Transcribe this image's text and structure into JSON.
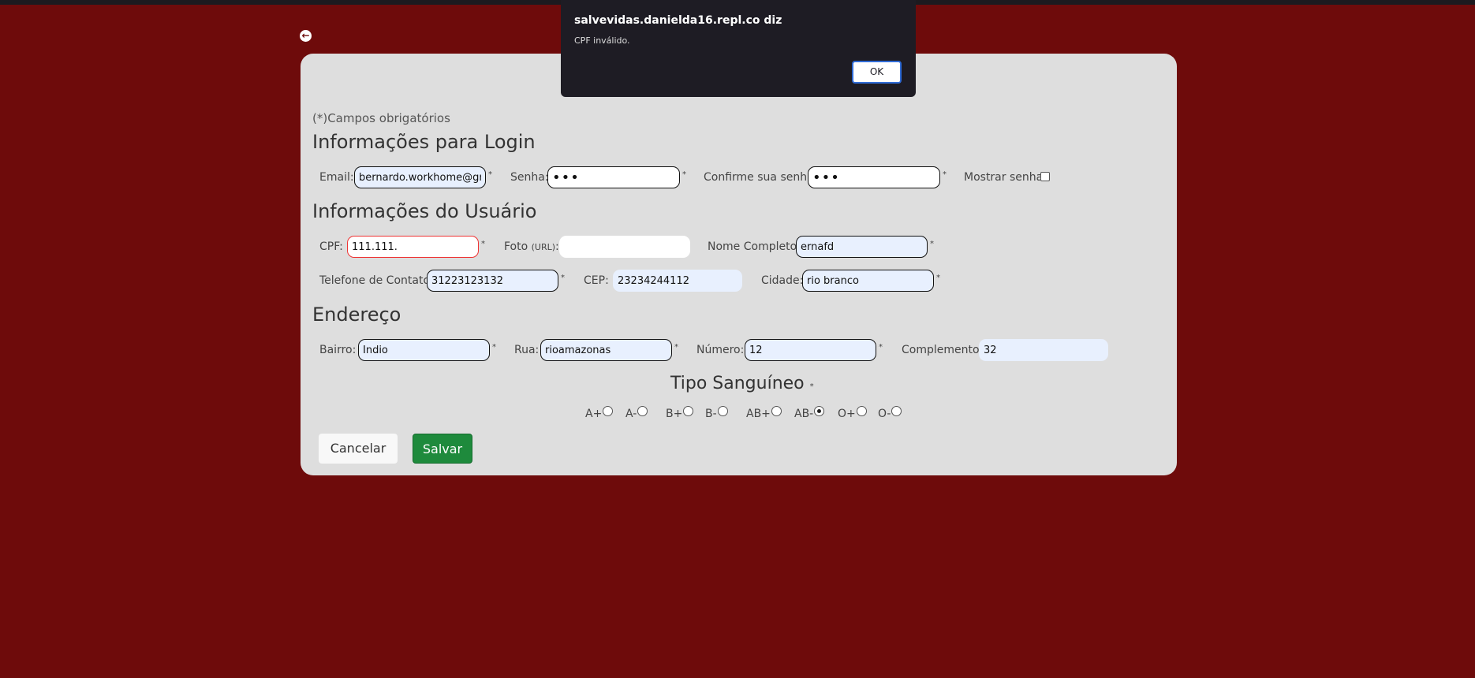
{
  "dialog": {
    "title": "salvevidas.danielda16.repl.co diz",
    "message": "CPF inválido.",
    "ok_label": "OK"
  },
  "form": {
    "required_note": "(*)Campos obrigatórios",
    "required_mark": "*",
    "login": {
      "heading": "Informações para Login",
      "email_label": "Email:",
      "email_value": "bernardo.workhome@gmail.com",
      "password_label": "Senha:",
      "password_value": "•••",
      "confirm_label": "Confirme sua senha:",
      "confirm_value": "•••",
      "show_password_label": "Mostrar senha",
      "show_password_checked": false
    },
    "user": {
      "heading": "Informações do Usuário",
      "cpf_label": "CPF:",
      "cpf_value": "111.111.",
      "photo_label": "Foto",
      "photo_label_suffix": "(URL)",
      "photo_label_colon": ":",
      "photo_value": "",
      "fullname_label": "Nome Completo:",
      "fullname_value": "ernafd",
      "phone_label": "Telefone de Contato:",
      "phone_value": "31223123132",
      "cep_label": "CEP:",
      "cep_value": "23234244112",
      "city_label": "Cidade:",
      "city_value": "rio branco"
    },
    "address": {
      "heading": "Endereço",
      "district_label": "Bairro:",
      "district_value": "Indio",
      "street_label": "Rua:",
      "street_value": "rioamazonas",
      "number_label": "Número:",
      "number_value": "12",
      "complement_label": "Complemento:",
      "complement_value": "32"
    },
    "blood": {
      "heading": "Tipo Sanguíneo",
      "options": [
        "A+",
        "A-",
        "B+",
        "B-",
        "AB+",
        "AB-",
        "O+",
        "O-"
      ],
      "selected": "AB-"
    },
    "buttons": {
      "cancel": "Cancelar",
      "save": "Salvar"
    }
  }
}
